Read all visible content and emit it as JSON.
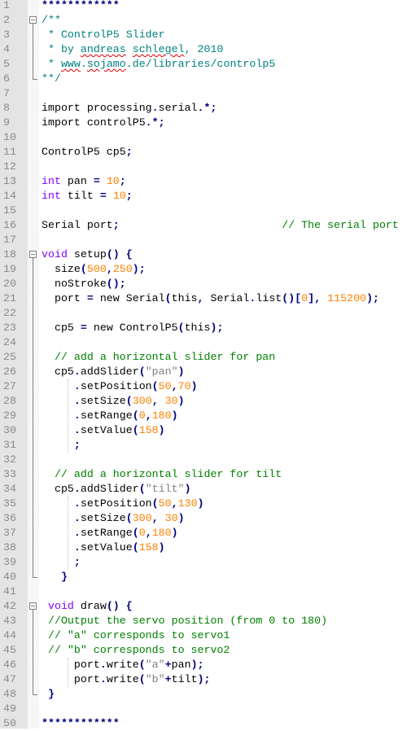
{
  "editor": {
    "colors": {
      "keyword": "#8000ff",
      "number": "#ff8000",
      "string": "#808080",
      "comment": "#008000",
      "doc_comment": "#008080",
      "operator": "#000080",
      "gutter": "#e4e4e4"
    },
    "lines": [
      [
        [
          "op",
          "************"
        ]
      ],
      [
        [
          "doc",
          "/**"
        ]
      ],
      [
        [
          "doc",
          " * ControlP5 Slider"
        ]
      ],
      [
        [
          "doc",
          " * by "
        ],
        [
          "docsq",
          "andreas"
        ],
        [
          "doc",
          " "
        ],
        [
          "docsq",
          "schlegel"
        ],
        [
          "doc",
          ", 2010"
        ]
      ],
      [
        [
          "doc",
          " * "
        ],
        [
          "docsq",
          "www"
        ],
        [
          "doc",
          "."
        ],
        [
          "docsq",
          "sojamo"
        ],
        [
          "doc",
          ".de/libraries/controlp5"
        ]
      ],
      [
        [
          "doc",
          "**/"
        ]
      ],
      [],
      [
        [
          "txt",
          "import processing"
        ],
        [
          "op",
          "."
        ],
        [
          "txt",
          "serial"
        ],
        [
          "op",
          ".*;"
        ]
      ],
      [
        [
          "txt",
          "import controlP5"
        ],
        [
          "op",
          ".*;"
        ]
      ],
      [],
      [
        [
          "txt",
          "ControlP5 cp5"
        ],
        [
          "op",
          ";"
        ]
      ],
      [],
      [
        [
          "kw",
          "int"
        ],
        [
          "txt",
          " pan "
        ],
        [
          "op",
          "="
        ],
        [
          "txt",
          " "
        ],
        [
          "num",
          "10"
        ],
        [
          "op",
          ";"
        ]
      ],
      [
        [
          "kw",
          "int"
        ],
        [
          "txt",
          " tilt "
        ],
        [
          "op",
          "="
        ],
        [
          "txt",
          " "
        ],
        [
          "num",
          "10"
        ],
        [
          "op",
          ";"
        ]
      ],
      [],
      [
        [
          "txt",
          "Serial port"
        ],
        [
          "op",
          ";"
        ],
        [
          "txt",
          "                         "
        ],
        [
          "cmt",
          "// The serial port"
        ]
      ],
      [],
      [
        [
          "kw",
          "void"
        ],
        [
          "txt",
          " setup"
        ],
        [
          "op",
          "()"
        ],
        [
          "txt",
          " "
        ],
        [
          "op",
          "{"
        ]
      ],
      [
        [
          "txt",
          "  size"
        ],
        [
          "op",
          "("
        ],
        [
          "num",
          "500"
        ],
        [
          "op",
          ","
        ],
        [
          "num",
          "250"
        ],
        [
          "op",
          ");"
        ]
      ],
      [
        [
          "txt",
          "  noStroke"
        ],
        [
          "op",
          "();"
        ]
      ],
      [
        [
          "txt",
          "  port "
        ],
        [
          "op",
          "="
        ],
        [
          "txt",
          " new Serial"
        ],
        [
          "op",
          "("
        ],
        [
          "txt",
          "this"
        ],
        [
          "op",
          ","
        ],
        [
          "txt",
          " Serial"
        ],
        [
          "op",
          "."
        ],
        [
          "txt",
          "list"
        ],
        [
          "op",
          "()["
        ],
        [
          "num",
          "0"
        ],
        [
          "op",
          "],"
        ],
        [
          "txt",
          " "
        ],
        [
          "num",
          "115200"
        ],
        [
          "op",
          ");"
        ]
      ],
      [],
      [
        [
          "txt",
          "  cp5 "
        ],
        [
          "op",
          "="
        ],
        [
          "txt",
          " new ControlP5"
        ],
        [
          "op",
          "("
        ],
        [
          "txt",
          "this"
        ],
        [
          "op",
          ");"
        ]
      ],
      [],
      [
        [
          "cmt",
          "  // add a horizontal slider for pan"
        ]
      ],
      [
        [
          "txt",
          "  cp5"
        ],
        [
          "op",
          "."
        ],
        [
          "txt",
          "addSlider"
        ],
        [
          "op",
          "("
        ],
        [
          "str",
          "\"pan\""
        ],
        [
          "op",
          ")"
        ]
      ],
      [
        [
          "txt",
          "     "
        ],
        [
          "op",
          "."
        ],
        [
          "txt",
          "setPosition"
        ],
        [
          "op",
          "("
        ],
        [
          "num",
          "50"
        ],
        [
          "op",
          ","
        ],
        [
          "num",
          "70"
        ],
        [
          "op",
          ")"
        ]
      ],
      [
        [
          "txt",
          "     "
        ],
        [
          "op",
          "."
        ],
        [
          "txt",
          "setSize"
        ],
        [
          "op",
          "("
        ],
        [
          "num",
          "300"
        ],
        [
          "op",
          ","
        ],
        [
          "txt",
          " "
        ],
        [
          "num",
          "30"
        ],
        [
          "op",
          ")"
        ]
      ],
      [
        [
          "txt",
          "     "
        ],
        [
          "op",
          "."
        ],
        [
          "txt",
          "setRange"
        ],
        [
          "op",
          "("
        ],
        [
          "num",
          "0"
        ],
        [
          "op",
          ","
        ],
        [
          "num",
          "180"
        ],
        [
          "op",
          ")"
        ]
      ],
      [
        [
          "txt",
          "     "
        ],
        [
          "op",
          "."
        ],
        [
          "txt",
          "setValue"
        ],
        [
          "op",
          "("
        ],
        [
          "num",
          "158"
        ],
        [
          "op",
          ")"
        ]
      ],
      [
        [
          "txt",
          "     "
        ],
        [
          "op",
          ";"
        ]
      ],
      [],
      [
        [
          "cmt",
          "  // add a horizontal slider for tilt"
        ]
      ],
      [
        [
          "txt",
          "  cp5"
        ],
        [
          "op",
          "."
        ],
        [
          "txt",
          "addSlider"
        ],
        [
          "op",
          "("
        ],
        [
          "str",
          "\"tilt\""
        ],
        [
          "op",
          ")"
        ]
      ],
      [
        [
          "txt",
          "     "
        ],
        [
          "op",
          "."
        ],
        [
          "txt",
          "setPosition"
        ],
        [
          "op",
          "("
        ],
        [
          "num",
          "50"
        ],
        [
          "op",
          ","
        ],
        [
          "num",
          "130"
        ],
        [
          "op",
          ")"
        ]
      ],
      [
        [
          "txt",
          "     "
        ],
        [
          "op",
          "."
        ],
        [
          "txt",
          "setSize"
        ],
        [
          "op",
          "("
        ],
        [
          "num",
          "300"
        ],
        [
          "op",
          ","
        ],
        [
          "txt",
          " "
        ],
        [
          "num",
          "30"
        ],
        [
          "op",
          ")"
        ]
      ],
      [
        [
          "txt",
          "     "
        ],
        [
          "op",
          "."
        ],
        [
          "txt",
          "setRange"
        ],
        [
          "op",
          "("
        ],
        [
          "num",
          "0"
        ],
        [
          "op",
          ","
        ],
        [
          "num",
          "180"
        ],
        [
          "op",
          ")"
        ]
      ],
      [
        [
          "txt",
          "     "
        ],
        [
          "op",
          "."
        ],
        [
          "txt",
          "setValue"
        ],
        [
          "op",
          "("
        ],
        [
          "num",
          "158"
        ],
        [
          "op",
          ")"
        ]
      ],
      [
        [
          "txt",
          "     "
        ],
        [
          "op",
          ";"
        ]
      ],
      [
        [
          "txt",
          "   "
        ],
        [
          "op",
          "}"
        ]
      ],
      [],
      [
        [
          "txt",
          " "
        ],
        [
          "kw",
          "void"
        ],
        [
          "txt",
          " draw"
        ],
        [
          "op",
          "()"
        ],
        [
          "txt",
          " "
        ],
        [
          "op",
          "{"
        ]
      ],
      [
        [
          "cmt",
          " //Output the servo position (from 0 to 180)"
        ]
      ],
      [
        [
          "cmt",
          " // \"a\" corresponds to servo1"
        ]
      ],
      [
        [
          "cmt",
          " // \"b\" corresponds to servo2"
        ]
      ],
      [
        [
          "txt",
          "     port"
        ],
        [
          "op",
          "."
        ],
        [
          "txt",
          "write"
        ],
        [
          "op",
          "("
        ],
        [
          "str",
          "\"a\""
        ],
        [
          "op",
          "+"
        ],
        [
          "txt",
          "pan"
        ],
        [
          "op",
          ");"
        ]
      ],
      [
        [
          "txt",
          "     port"
        ],
        [
          "op",
          "."
        ],
        [
          "txt",
          "write"
        ],
        [
          "op",
          "("
        ],
        [
          "str",
          "\"b\""
        ],
        [
          "op",
          "+"
        ],
        [
          "txt",
          "tilt"
        ],
        [
          "op",
          ");"
        ]
      ],
      [
        [
          "txt",
          " "
        ],
        [
          "op",
          "}"
        ]
      ],
      [],
      [
        [
          "op",
          "************"
        ]
      ]
    ]
  }
}
